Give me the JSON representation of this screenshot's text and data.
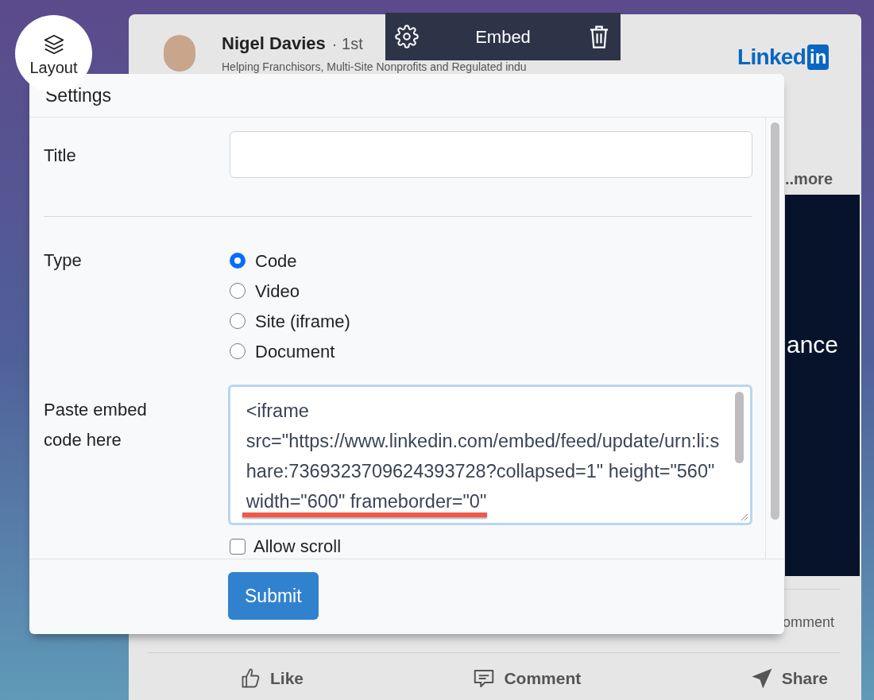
{
  "background_post": {
    "author": {
      "name": "Nigel Davies",
      "degree": "· 1st",
      "headline": "Helping Franchisors, Multi-Site Nonprofits and Regulated indu"
    },
    "logo": {
      "text": "Linked",
      "badge": "in"
    },
    "more_link": "..more",
    "media_text": "ance",
    "count_text": "omment",
    "actions": [
      {
        "kind": "like",
        "label": "Like"
      },
      {
        "kind": "comment",
        "label": "Comment"
      },
      {
        "kind": "share",
        "label": "Share"
      }
    ]
  },
  "block_toolbar": {
    "title": "Embed"
  },
  "layout_button": {
    "label": "Layout"
  },
  "settings_dialog": {
    "title": "Settings",
    "title_field": {
      "label": "Title"
    },
    "type_field": {
      "label": "Type",
      "options": [
        {
          "label": "Code",
          "selected": true
        },
        {
          "label": "Video",
          "selected": false
        },
        {
          "label": "Site (iframe)",
          "selected": false
        },
        {
          "label": "Document",
          "selected": false
        }
      ]
    },
    "embed_field": {
      "label": "Paste embed code here",
      "value": "<iframe src=\"https://www.linkedin.com/embed/feed/update/urn:li:share:7369323709624393728?collapsed=1\" height=\"560\" width=\"600\" frameborder=\"0\""
    },
    "allow_scroll": {
      "label": "Allow scroll",
      "checked": false
    },
    "submit": "Submit"
  }
}
